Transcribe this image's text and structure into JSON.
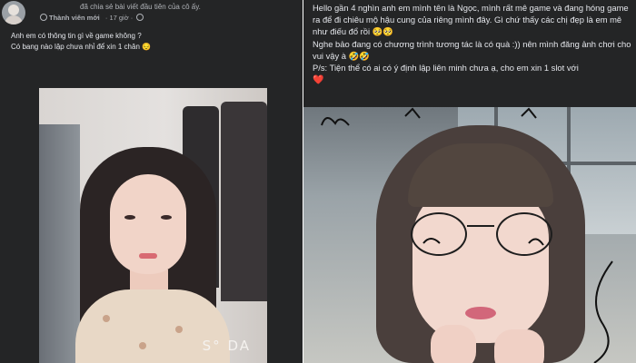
{
  "left_post": {
    "shared_text": "đã chia sẻ bài viết đầu tiên của cô ấy.",
    "member_label": "Thành viên mới",
    "time_text": "· 17 giờ ·",
    "body_line1": "Anh em có thông tin gì về game không ?",
    "body_line2": "Có bang nào lập chưa nhỉ để xin 1 chân 😔",
    "watermark": "S° DA"
  },
  "right_post": {
    "paragraph1": "Hello gần 4 nghìn anh em mình tên là Ngọc, mình rất mê game và đang hóng game ra để đi chiêu mộ hậu cung của riêng mình đây. Gì chứ thấy các chị đẹp là em mê như điếu đổ rồi 🥺🥺",
    "paragraph2": "Nghe bảo đang có chương trình tương tác là có quà :)) nên mình đăng ảnh chơi cho vui vậy à 🤣🤣",
    "paragraph3": "P/s: Tiện thể có ai có ý định lập liên minh chưa ạ, cho em xin 1 slot với",
    "heart": "❤️"
  },
  "icons": {
    "avatar": "avatar",
    "member_badge": "badge-icon",
    "privacy": "globe-icon",
    "heart": "heart-icon"
  },
  "colors": {
    "card_bg": "#242526",
    "text_primary": "#e4e6eb",
    "text_secondary": "#b0b3b8",
    "heart": "#e0245e"
  }
}
